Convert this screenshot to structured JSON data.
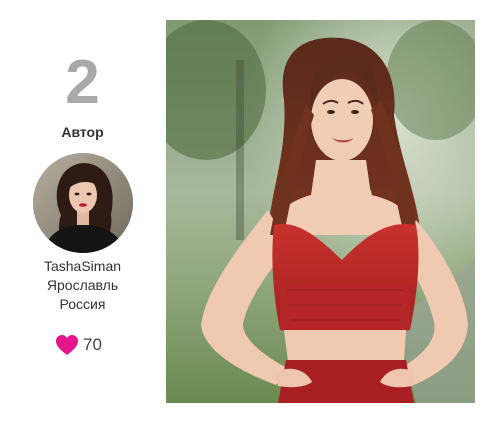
{
  "entry": {
    "rank": "2",
    "role_label": "Автор",
    "author": {
      "username": "TashaSiman",
      "city": "Ярославль",
      "country": "Россия"
    },
    "likes": {
      "count": "70",
      "icon": "heart-icon",
      "color": "#e6148c"
    }
  },
  "colors": {
    "rank": "#a9a9a9",
    "text": "#333333",
    "accent": "#e6148c"
  }
}
